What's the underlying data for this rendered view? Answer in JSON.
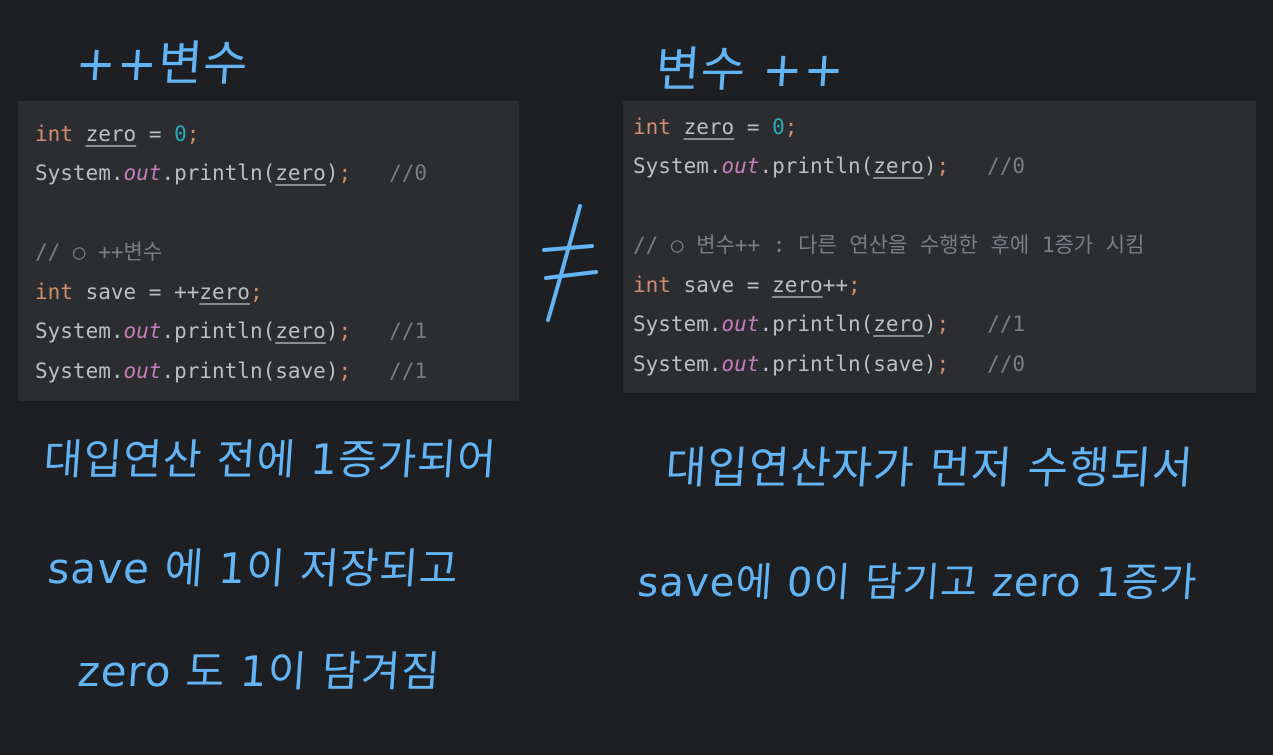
{
  "headings": {
    "left": "++변수",
    "right": "변수 ++"
  },
  "left_panel": {
    "line1": {
      "kw": "int",
      "var": "zero",
      "eq": " = ",
      "num": "0",
      "semi": ";"
    },
    "line2": {
      "sys": "System.",
      "out": "out",
      "call": ".println(",
      "var": "zero",
      "close": ")",
      "semi": ";",
      "comment": "   //0"
    },
    "line3": {
      "comment": "// ○ ++변수"
    },
    "line4": {
      "kw": "int",
      "rest": " save = ++",
      "var": "zero",
      "semi": ";"
    },
    "line5": {
      "sys": "System.",
      "out": "out",
      "call": ".println(",
      "var": "zero",
      "close": ")",
      "semi": ";",
      "comment": "   //1"
    },
    "line6": {
      "sys": "System.",
      "out": "out",
      "call": ".println(save)",
      "semi": ";",
      "comment": "   //1"
    }
  },
  "right_panel": {
    "line1": {
      "kw": "int",
      "var": "zero",
      "eq": " = ",
      "num": "0",
      "semi": ";"
    },
    "line2": {
      "sys": "System.",
      "out": "out",
      "call": ".println(",
      "var": "zero",
      "close": ")",
      "semi": ";",
      "comment": "   //0"
    },
    "line3": {
      "comment": "// ○ 변수++ : 다른 연산을 수행한 후에 1증가 시킴"
    },
    "line4": {
      "kw": "int",
      "rest": " save = ",
      "var": "zero",
      "post": "++",
      "semi": ";"
    },
    "line5": {
      "sys": "System.",
      "out": "out",
      "call": ".println(",
      "var": "zero",
      "close": ")",
      "semi": ";",
      "comment": "   //1"
    },
    "line6": {
      "sys": "System.",
      "out": "out",
      "call": ".println(save)",
      "semi": ";",
      "comment": "   //0"
    }
  },
  "not_equal_symbol": "≠",
  "notes_left": {
    "line1": "대입연산 전에 1증가되어",
    "line2": "save 에   1이 저장되고",
    "line3": "zero 도  1이 담겨짐"
  },
  "notes_right": {
    "line1": "대입연산자가 먼저 수행되서",
    "line2": "save에 0이 담기고  zero 1증가"
  },
  "colors": {
    "background": "#1e1f22",
    "panel": "#2b2d30",
    "handwriting": "#62b4f5",
    "keyword": "#cf8e6d",
    "number": "#2aacb8",
    "static_field": "#c77dbb",
    "comment": "#7a7e85",
    "text": "#bcbec4"
  }
}
